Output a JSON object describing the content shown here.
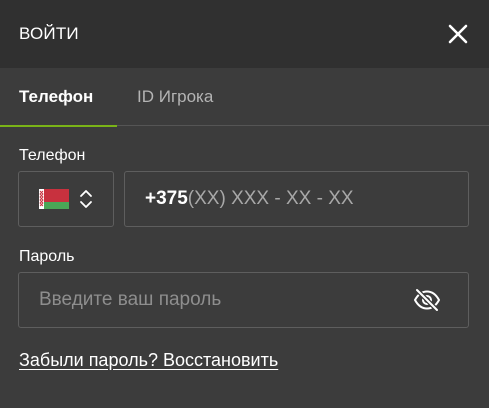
{
  "header": {
    "title": "ВОЙТИ",
    "close_icon": "close-icon"
  },
  "tabs": [
    {
      "label": "Телефон",
      "active": true
    },
    {
      "label": "ID Игрока",
      "active": false
    }
  ],
  "phone": {
    "label": "Телефон",
    "country_flag": "belarus-flag-icon",
    "selector_icon": "chevron-up-down-icon",
    "code": "+375",
    "mask": "(XX) XXX - XX - XX"
  },
  "password": {
    "label": "Пароль",
    "placeholder": "Введите ваш пароль",
    "toggle_icon": "eye-off-icon"
  },
  "forgot_link": "Забыли пароль? Восстановить",
  "colors": {
    "accent": "#7ab317",
    "header_bg": "#303030",
    "body_bg": "#3c3c3c",
    "border": "#5e5e5e"
  }
}
